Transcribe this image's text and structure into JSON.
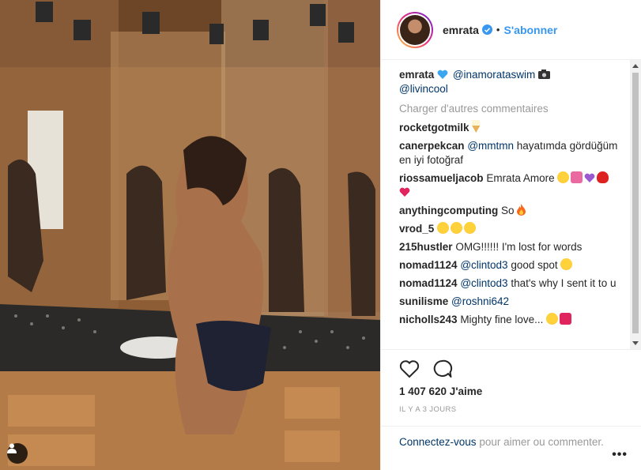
{
  "post": {
    "username": "emrata",
    "follow_label": "S'abonner",
    "separator": "•",
    "caption": {
      "username": "emrata",
      "mention1": "@inamorataswim",
      "mention2": "@livincool"
    },
    "load_more_label": "Charger d'autres commentaires",
    "comments": [
      {
        "user": "rocketgotmilk",
        "text": "",
        "emoji": "ice-cream"
      },
      {
        "user": "canerpekcan",
        "mention": "@mmtmn",
        "text": " hayatımda gördüğüm en iyi fotoğraf"
      },
      {
        "user": "riossamueljacob",
        "text": "Emrata Amore"
      },
      {
        "user": "anythingcomputing",
        "text": "So"
      },
      {
        "user": "vrod_5",
        "text": ""
      },
      {
        "user": "215hustler",
        "text": "OMG!!!!!! I'm lost for words"
      },
      {
        "user": "nomad1124",
        "mention": "@clintod3",
        "text": " good spot"
      },
      {
        "user": "nomad1124",
        "mention": "@clintod3",
        "text": " that's why I sent it to u"
      },
      {
        "user": "sunilisme",
        "mention": "@roshni642",
        "text": ""
      },
      {
        "user": "nicholls243",
        "text": "Mighty fine love..."
      }
    ],
    "likes_label": "1 407 620 J'aime",
    "time_label": "IL Y A 3 JOURS",
    "login_link": "Connectez-vous",
    "login_text": " pour aimer ou commenter.",
    "more_label": "•••"
  },
  "icons": {
    "like": "heart-outline-icon",
    "comment": "speech-bubble-icon",
    "verified": "verified-badge-icon",
    "user_tag": "person-icon",
    "more": "ellipsis-icon"
  },
  "colors": {
    "link": "#003569",
    "follow": "#3897f0",
    "muted": "#999999",
    "text": "#262626"
  }
}
